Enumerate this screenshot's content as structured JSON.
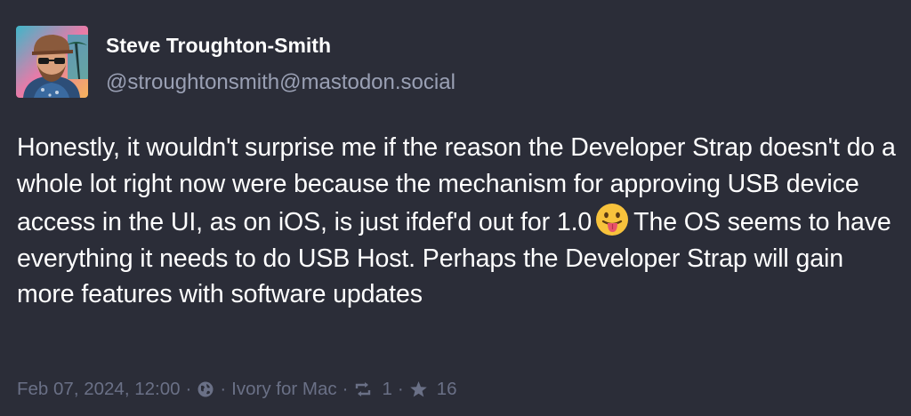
{
  "author": {
    "display_name": "Steve Troughton-Smith",
    "handle": "@stroughtonsmith@mastodon.social",
    "avatar_icon": "avatar-photo"
  },
  "post": {
    "text_before_emoji": "Honestly, it wouldn't surprise me if the reason the Developer Strap doesn't do a whole lot right now were because the mechanism for approving USB device access in the UI, as on iOS, is just ifdef'd out for 1.0",
    "emoji": "tongue-out-emoji",
    "text_after_emoji": "The OS seems to have everything it needs to do USB Host. Perhaps the Developer Strap will gain more features with software updates"
  },
  "meta": {
    "date": "Feb 07, 2024, 12:00",
    "separator": "·",
    "visibility_icon": "globe-icon",
    "client": "Ivory for Mac",
    "boost_icon": "boost-icon",
    "boost_count": "1",
    "favourite_icon": "star-icon",
    "favourite_count": "16"
  },
  "colors": {
    "background": "#2b2d38",
    "text": "#ffffff",
    "muted": "#9aa0b4",
    "meta": "#6a7086"
  }
}
